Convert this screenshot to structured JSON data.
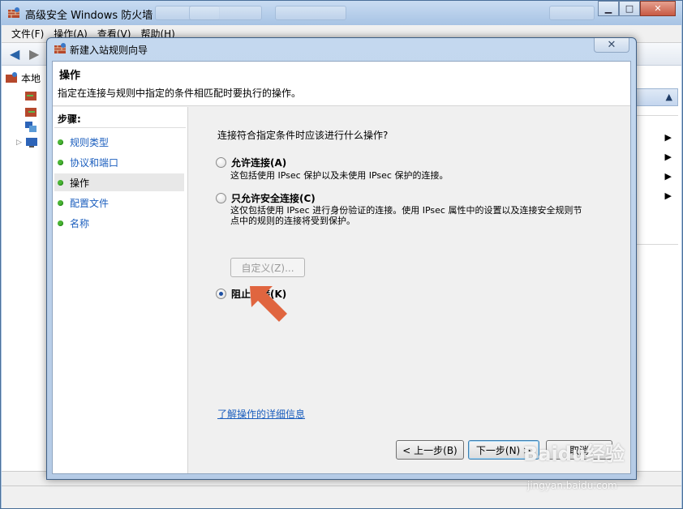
{
  "main_window": {
    "title": "高级安全 Windows 防火墙",
    "menus": [
      "文件(F)",
      "操作(A)",
      "查看(V)",
      "帮助(H)"
    ],
    "tree_root": "本地"
  },
  "dialog": {
    "title": "新建入站规则向导",
    "header_title": "操作",
    "header_desc": "指定在连接与规则中指定的条件相匹配时要执行的操作。",
    "steps_title": "步骤:",
    "steps": [
      {
        "label": "规则类型",
        "active": false
      },
      {
        "label": "协议和端口",
        "active": false
      },
      {
        "label": "操作",
        "active": true
      },
      {
        "label": "配置文件",
        "active": false
      },
      {
        "label": "名称",
        "active": false
      }
    ],
    "question": "连接符合指定条件时应该进行什么操作?",
    "options": [
      {
        "label": "允许连接(A)",
        "desc": "这包括使用 IPsec 保护以及未使用 IPsec 保护的连接。",
        "checked": false
      },
      {
        "label": "只允许安全连接(C)",
        "desc": "这仅包括使用 IPsec 进行身份验证的连接。使用 IPsec 属性中的设置以及连接安全规则节点中的规则的连接将受到保护。",
        "checked": false
      },
      {
        "label": "阻止连接(K)",
        "desc": "",
        "checked": true
      }
    ],
    "customize_label": "自定义(Z)...",
    "learn_more": "了解操作的详细信息",
    "buttons": {
      "back": "< 上一步(B)",
      "next": "下一步(N) >",
      "cancel": "取消"
    }
  },
  "watermark": {
    "brand": "Baidu经验",
    "url": "jingyan.baidu.com"
  },
  "colors": {
    "accent_link": "#1b5ebe",
    "step_dot": "#4ab535",
    "arrow": "#e0653f"
  }
}
